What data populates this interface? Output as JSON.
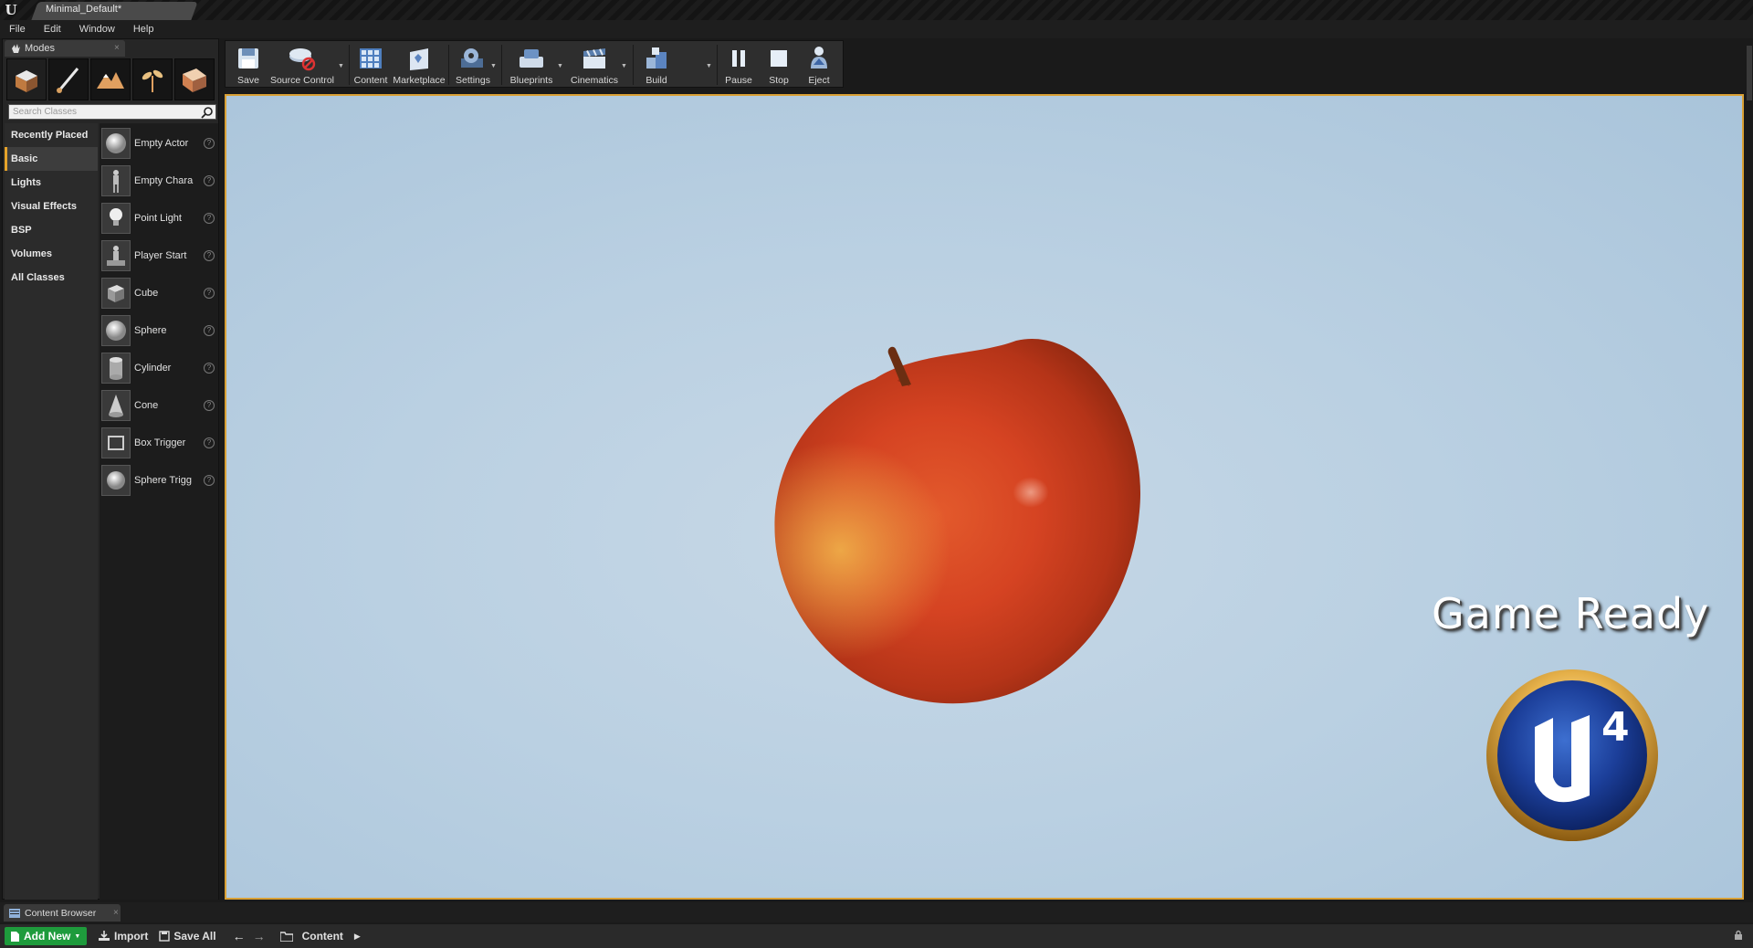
{
  "window": {
    "app_logo": "U",
    "doc_tab": "Minimal_Default*"
  },
  "menu": [
    "File",
    "Edit",
    "Window",
    "Help"
  ],
  "modes": {
    "tab_label": "Modes",
    "close": "×",
    "mode_icons": [
      "place-mode-icon",
      "paint-mode-icon",
      "landscape-mode-icon",
      "foliage-mode-icon",
      "geometry-mode-icon"
    ],
    "search_placeholder": "Search Classes",
    "categories": [
      "Recently Placed",
      "Basic",
      "Lights",
      "Visual Effects",
      "BSP",
      "Volumes",
      "All Classes"
    ],
    "selected_category": "Basic",
    "classes": [
      "Empty Actor",
      "Empty Chara",
      "Point Light",
      "Player Start",
      "Cube",
      "Sphere",
      "Cylinder",
      "Cone",
      "Box Trigger",
      "Sphere Trigg"
    ],
    "help_glyph": "?"
  },
  "toolbar": {
    "save": "Save",
    "source_control": "Source Control",
    "content": "Content",
    "marketplace": "Marketplace",
    "settings": "Settings",
    "blueprints": "Blueprints",
    "cinematics": "Cinematics",
    "build": "Build",
    "pause": "Pause",
    "stop": "Stop",
    "eject": "Eject"
  },
  "viewport": {
    "overlay_text": "Game Ready",
    "engine_logo": "U4"
  },
  "content_browser": {
    "tab_label": "Content Browser",
    "close": "×",
    "add_new": "Add New",
    "import": "Import",
    "save_all": "Save All",
    "path": "Content"
  },
  "colors": {
    "accent": "#d9a035",
    "add_new_green": "#1e9b3c",
    "viewport_bg": "#bad0e2"
  }
}
